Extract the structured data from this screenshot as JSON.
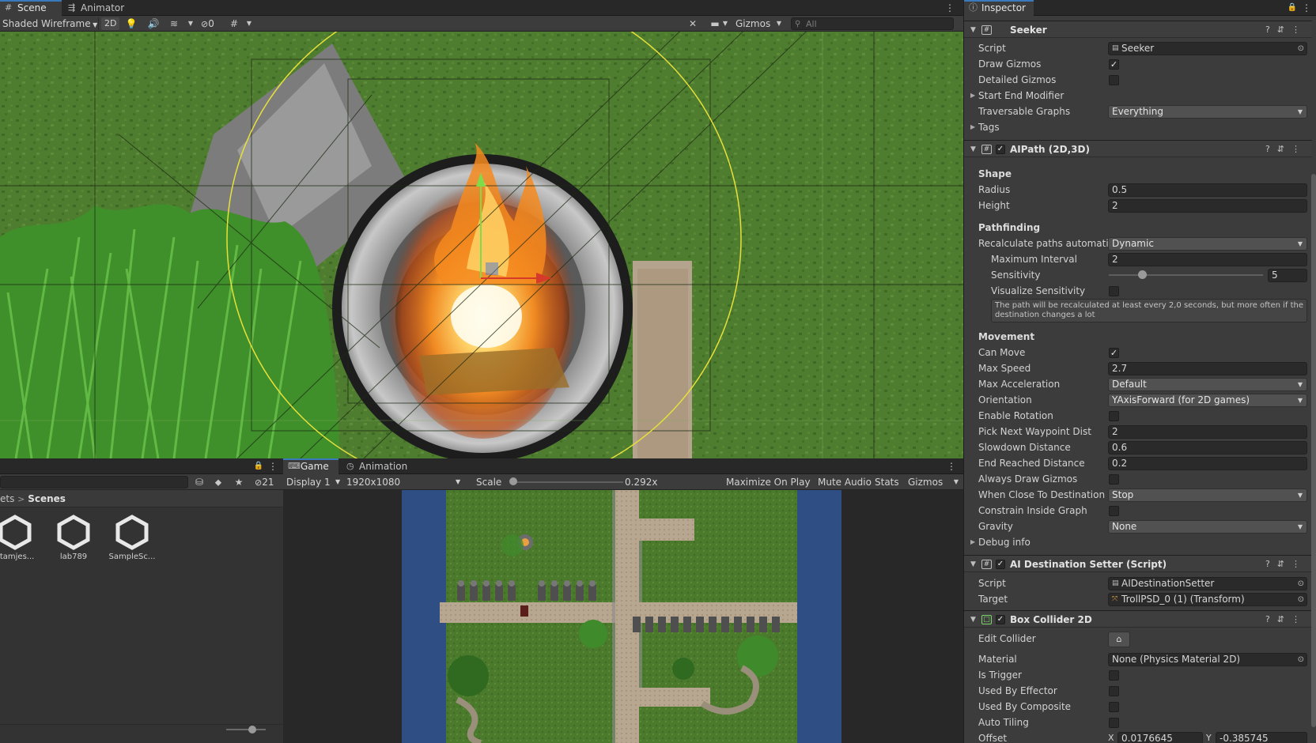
{
  "scene_tabs": {
    "scene": "Scene",
    "animator": "Animator"
  },
  "scene_toolbar": {
    "draw_mode": "Shaded Wireframe",
    "mode_2d": "2D",
    "hidden_count": "0",
    "gizmos": "Gizmos",
    "search_placeholder": "All"
  },
  "inspector": {
    "tab": "Inspector",
    "seeker": {
      "title": "Seeker",
      "rows": {
        "script_label": "Script",
        "script_value": "Seeker",
        "draw_gizmos": "Draw Gizmos",
        "detailed_gizmos": "Detailed Gizmos",
        "start_end_modifier": "Start End Modifier",
        "traversable_graphs": "Traversable Graphs",
        "traversable_value": "Everything",
        "tags": "Tags"
      }
    },
    "aipath": {
      "title": "AIPath (2D,3D)",
      "shape": "Shape",
      "radius_label": "Radius",
      "radius_value": "0.5",
      "height_label": "Height",
      "height_value": "2",
      "pathfinding": "Pathfinding",
      "recalc_label": "Recalculate paths automatic",
      "recalc_value": "Dynamic",
      "max_interval_label": "Maximum Interval",
      "max_interval_value": "2",
      "sensitivity_label": "Sensitivity",
      "sensitivity_value": "5",
      "sensitivity_fraction": 0.2,
      "visualize_label": "Visualize Sensitivity",
      "help_text": "The path will be recalculated at least every 2,0 seconds, but more often if the destination changes a lot",
      "movement": "Movement",
      "can_move": "Can Move",
      "max_speed_label": "Max Speed",
      "max_speed_value": "2.7",
      "max_accel_label": "Max Acceleration",
      "max_accel_value": "Default",
      "orientation_label": "Orientation",
      "orientation_value": "YAxisForward (for 2D games)",
      "enable_rotation": "Enable Rotation",
      "pick_next_label": "Pick Next Waypoint Dist",
      "pick_next_value": "2",
      "slowdown_label": "Slowdown Distance",
      "slowdown_value": "0.6",
      "end_reached_label": "End Reached Distance",
      "end_reached_value": "0.2",
      "always_draw": "Always Draw Gizmos",
      "when_close_label": "When Close To Destination",
      "when_close_value": "Stop",
      "constrain": "Constrain Inside Graph",
      "gravity_label": "Gravity",
      "gravity_value": "None",
      "debug_info": "Debug info"
    },
    "dest_setter": {
      "title": "AI Destination Setter (Script)",
      "script_label": "Script",
      "script_value": "AIDestinationSetter",
      "target_label": "Target",
      "target_value": "TrollPSD_0 (1) (Transform)"
    },
    "box_collider": {
      "title": "Box Collider 2D",
      "edit_collider": "Edit Collider",
      "material_label": "Material",
      "material_value": "None (Physics Material 2D)",
      "is_trigger": "Is Trigger",
      "used_by_effector": "Used By Effector",
      "used_by_composite": "Used By Composite",
      "auto_tiling": "Auto Tiling",
      "offset_label": "Offset",
      "offset_x": "0.0176645",
      "offset_y": "-0.385745"
    }
  },
  "project": {
    "hidden_count": "21",
    "breadcrumb_prev": "ets",
    "breadcrumb_current": "Scenes",
    "assets": [
      "stamjes...",
      "lab789",
      "SampleSc..."
    ]
  },
  "game": {
    "tab_game": "Game",
    "tab_animation": "Animation",
    "display": "Display 1",
    "resolution": "1920x1080",
    "scale_label": "Scale",
    "scale_value": "0.292x",
    "maximize": "Maximize On Play",
    "mute": "Mute Audio",
    "stats": "Stats",
    "gizmos": "Gizmos"
  },
  "colors": {
    "accent": "#3a79bb",
    "grass": "#4a7a2e",
    "water": "#2f4f86",
    "path": "#b9a58f"
  }
}
